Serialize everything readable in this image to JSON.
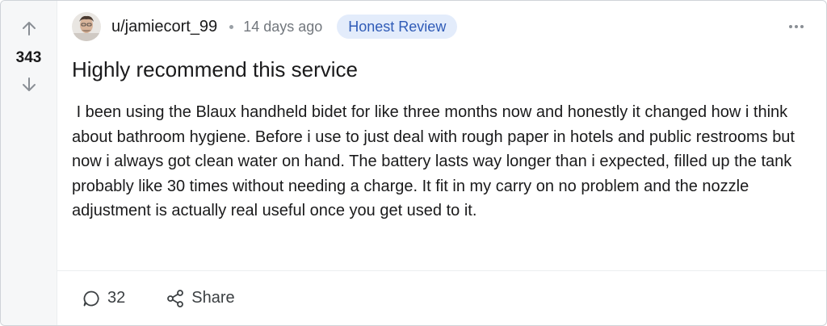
{
  "vote": {
    "count": "343",
    "up_icon": "arrow-up-icon",
    "down_icon": "arrow-down-icon"
  },
  "post": {
    "username": "u/jamiecort_99",
    "time": "14 days ago",
    "flair": "Honest Review",
    "title": "Highly recommend this service",
    "body": " I been using the Blaux handheld bidet for like three months now and honestly it changed how i think about bathroom hygiene. Before i use to just deal with rough paper in hotels and public restrooms but now i always got clean water on hand. The battery lasts way longer than i expected, filled up the tank probably like 30 times without needing a charge. It fit in my carry on no problem and the nozzle adjustment is actually real useful once you get used to it."
  },
  "footer": {
    "comments_count": "32",
    "share_label": "Share"
  },
  "colors": {
    "flair_bg": "#e3ecfb",
    "flair_text": "#2f5bb7",
    "rail_bg": "#f6f7f8"
  }
}
